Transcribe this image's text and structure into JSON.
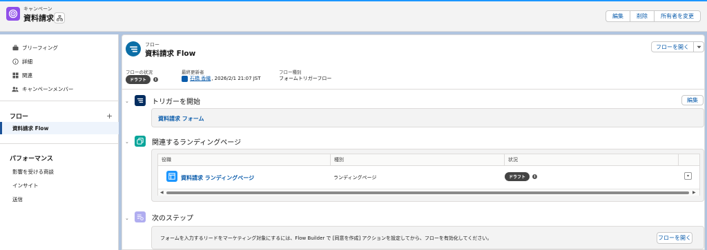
{
  "header": {
    "eyebrow": "キャンペーン",
    "title": "資料請求",
    "icon": "campaign-target-icon",
    "actions": [
      "編集",
      "削除",
      "所有者を変更"
    ]
  },
  "sidebar": {
    "items": [
      {
        "label": "ブリーフィング",
        "icon": "briefcase-icon"
      },
      {
        "label": "詳細",
        "icon": "info-icon"
      },
      {
        "label": "関連",
        "icon": "grid-icon"
      },
      {
        "label": "キャンペーンメンバー",
        "icon": "people-icon"
      }
    ],
    "flow_section": "フロー",
    "flow_add": "+",
    "flow_selected": "資料請求 Flow",
    "performance_section": "パフォーマンス",
    "performance_items": [
      "影響を受ける商談",
      "インサイト",
      "送信"
    ]
  },
  "flow": {
    "eyebrow": "フロー",
    "title": "資料請求 Flow",
    "open_button": "フローを開く",
    "status_label": "フローの状況",
    "status_value": "ドラフト",
    "modifier_label": "最終更新者",
    "modifier_name": "石橋 香織",
    "modified_date": ", 2026/2/1 21:07 JST",
    "type_label": "フロー種別",
    "type_value": "フォームトリガーフロー"
  },
  "trigger": {
    "title": "トリガーを開始",
    "edit_button": "編集",
    "form_link": "資料請求 フォーム"
  },
  "landing": {
    "title": "関連するランディングページ",
    "columns": [
      "役職",
      "種別",
      "状況"
    ],
    "rows": [
      {
        "name": "資料請求 ランディングページ",
        "type": "ランディングページ",
        "status": "ドラフト"
      }
    ]
  },
  "next": {
    "title": "次のステップ",
    "text": "フォームを入力するリードをマーケティング対象にするには、Flow Builder で [同意を作成] アクションを設定してから、フローを有効化してください。",
    "button": "フローを開く"
  },
  "colors": {
    "brand_blue": "#0b5cab",
    "campaign_purple": "#9050e9",
    "trigger_navy": "#032d60",
    "landing_teal": "#06a59a",
    "next_steps_lavender": "#b0adf0",
    "draft_badge": "#444444"
  }
}
